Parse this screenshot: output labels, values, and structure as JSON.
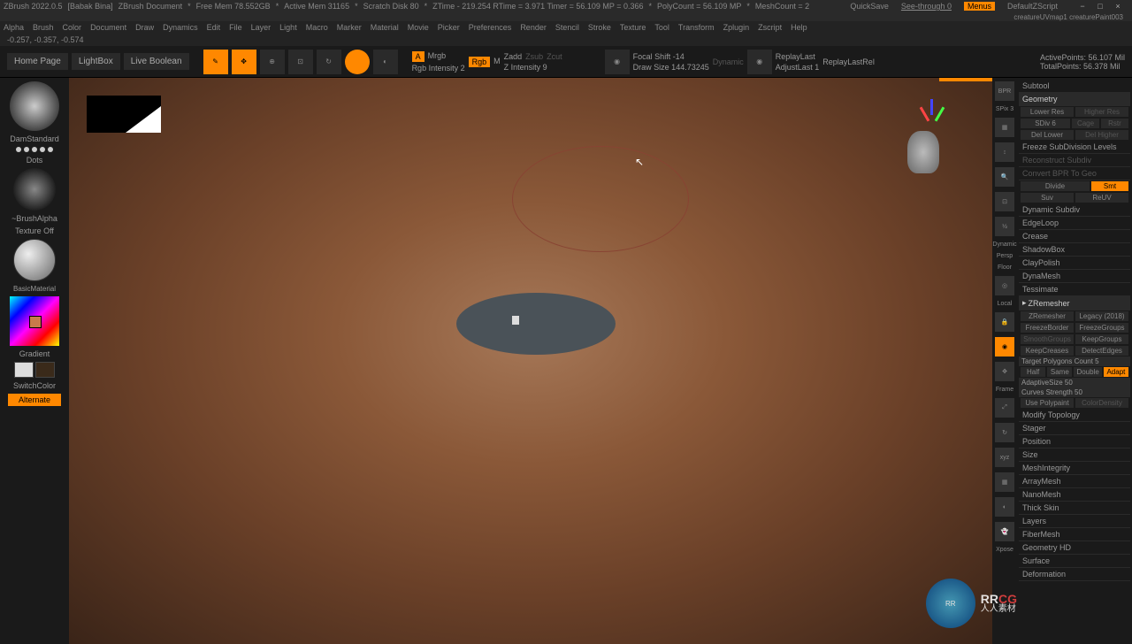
{
  "titlebar": {
    "app": "ZBrush 2022.0.5",
    "user": "[Babak Bina]",
    "doc": "ZBrush Document",
    "freemem": "Free Mem 78.552GB",
    "activemem": "Active Mem 31165",
    "scratch": "Scratch Disk 80",
    "ztime": "ZTime - 219.254 RTime = 3.971 Timer = 56.109 MP = 0.366",
    "polycount": "PolyCount = 56.109 MP",
    "meshcount": "MeshCount = 2",
    "quicksave": "QuickSave",
    "seethrough": "See-through 0",
    "menus": "Menus",
    "script": "DefaultZScript",
    "filename": "creatureUVmap1 creaturePaint003"
  },
  "menubar": [
    "Alpha",
    "Brush",
    "Color",
    "Document",
    "Draw",
    "Dynamics",
    "Edit",
    "File",
    "Layer",
    "Light",
    "Macro",
    "Marker",
    "Material",
    "Movie",
    "Picker",
    "Preferences",
    "Render",
    "Stencil",
    "Stroke",
    "Texture",
    "Tool",
    "Transform",
    "Zplugin",
    "Zscript",
    "Help"
  ],
  "status": "-0.257, -0.357, -0.574",
  "toolbar": {
    "home": "Home Page",
    "lightbox": "LightBox",
    "liveboolean": "Live Boolean",
    "mrgb_a": "A",
    "mrgb": "Mrgb",
    "rgb": "Rgb",
    "m": "M",
    "zadd": "Zadd",
    "zsub": "Zsub",
    "zcut": "Zcut",
    "rgb_intensity": "Rgb Intensity 2",
    "z_intensity": "Z Intensity 9",
    "focal": "Focal Shift -14",
    "drawsize": "Draw Size 144.73245",
    "dynamic": "Dynamic",
    "replaylast": "ReplayLast",
    "replaylastrel": "ReplayLastRel",
    "adjustlast": "AdjustLast 1",
    "activepoints": "ActivePoints: 56.107 Mil",
    "totalpoints": "TotalPoints: 56.378 Mil"
  },
  "left": {
    "brush": "DamStandard",
    "dots": "Dots",
    "brushalpha": "~BrushAlpha",
    "texture": "Texture Off",
    "material": "BasicMaterial",
    "gradient": "Gradient",
    "switchcolor": "SwitchColor",
    "alternate": "Alternate"
  },
  "iconstrip": {
    "spix": "SPix 3",
    "dynamic": "Dynamic",
    "persp": "Persp",
    "floor": "Floor",
    "local": "Local",
    "frame": "Frame",
    "xpose": "Xpose"
  },
  "right": {
    "subtool": "Subtool",
    "geometry": "Geometry",
    "lowerres": "Lower Res",
    "higherres": "Higher Res",
    "sdiv": "SDiv 6",
    "cage": "Cage",
    "rstr": "Rstr",
    "dellower": "Del Lower",
    "delhigher": "Del Higher",
    "freeze": "Freeze SubDivision Levels",
    "reconstruct": "Reconstruct Subdiv",
    "convertbpr": "Convert BPR To Geo",
    "divide": "Divide",
    "smt": "Smt",
    "suv": "Suv",
    "reluv": "ReUV",
    "dynamicsubdiv": "Dynamic Subdiv",
    "edgeloop": "EdgeLoop",
    "crease": "Crease",
    "shadowbox": "ShadowBox",
    "claypolish": "ClayPolish",
    "dynamesh": "DynaMesh",
    "tessimate": "Tessimate",
    "zremesher": "ZRemesher",
    "zremesher_btn": "ZRemesher",
    "legacy": "Legacy (2018)",
    "freezeborder": "FreezeBorder",
    "freezegroups": "FreezeGroups",
    "smoothgroups": "SmoothGroups",
    "keepgroups": "KeepGroups",
    "keepcreases": "KeepCreases",
    "detectedges": "DetectEdges",
    "targetpoly": "Target Polygons Count 5",
    "half": "Half",
    "same": "Same",
    "double": "Double",
    "adapt": "Adapt",
    "adaptivesize": "AdaptiveSize 50",
    "curvesstrength": "Curves Strength 50",
    "usepolypaint": "Use Polypaint",
    "colordensity": "ColorDensity",
    "modifytopology": "Modify Topology",
    "stager": "Stager",
    "position": "Position",
    "size": "Size",
    "meshintegrity": "MeshIntegrity",
    "arraymesh": "ArrayMesh",
    "nanomesh": "NanoMesh",
    "thickskin": "Thick Skin",
    "layers": "Layers",
    "fibermesh": "FiberMesh",
    "geometryhd": "Geometry HD",
    "surface": "Surface",
    "deformation": "Deformation"
  },
  "watermark": {
    "line1": "RR",
    "line2": "CG",
    "sub": "人人素材"
  }
}
